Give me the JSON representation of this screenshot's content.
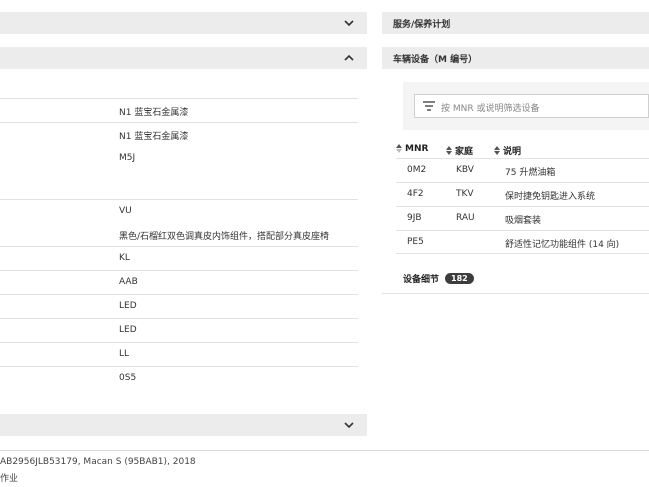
{
  "sections": {
    "left_top": {
      "title": ""
    },
    "left_expanded": {
      "title": ""
    },
    "left_bottom": {
      "title": ""
    },
    "service_plan": {
      "title": "服务/保养计划"
    },
    "equipment": {
      "title": "车辆设备（M 编号）"
    }
  },
  "left_values": [
    [
      "N1 蓝宝石金属漆"
    ],
    [
      "N1 蓝宝石金属漆",
      "M5J"
    ],
    [
      "VU",
      "黑色/石榴红双色调真皮内饰组件，搭配部分真皮座椅"
    ],
    [
      "KL"
    ],
    [
      "AAB"
    ],
    [
      "LED"
    ],
    [
      "LED"
    ],
    [
      "LL"
    ],
    [
      "0S5"
    ]
  ],
  "equipment": {
    "filter_placeholder": "按 MNR 或说明筛选设备",
    "columns": {
      "mnr": "MNR",
      "family": "家庭",
      "desc": "说明"
    },
    "rows": [
      {
        "mnr": "0M2",
        "family": "KBV",
        "desc": "75 升燃油箱"
      },
      {
        "mnr": "4F2",
        "family": "TKV",
        "desc": "保时捷免钥匙进入系统"
      },
      {
        "mnr": "9JB",
        "family": "RAU",
        "desc": "吸烟套装"
      },
      {
        "mnr": "PE5",
        "family": "",
        "desc": "舒适性记忆功能组件 (14 向)"
      }
    ],
    "details_label": "设备细节",
    "details_count": "182"
  },
  "footer": {
    "vehicle": "AB2956JLB53179, Macan S (95BAB1), 2018",
    "line2": "作业"
  }
}
